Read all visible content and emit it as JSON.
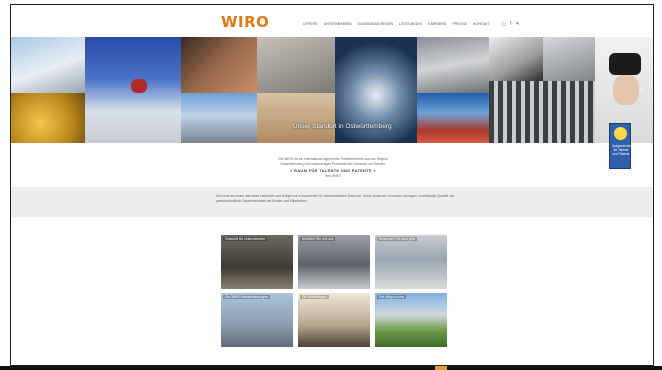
{
  "header": {
    "logo": "WIRO",
    "nav": [
      "Offers",
      "Unternehmen",
      "Gemeinsam reden",
      "Leistungen",
      "Karriere",
      "Presse",
      "Kontakt"
    ],
    "social": [
      {
        "name": "instagram-icon",
        "glyph": "◻"
      },
      {
        "name": "facebook-icon",
        "glyph": "f"
      },
      {
        "name": "xing-icon",
        "glyph": "✕"
      }
    ]
  },
  "slider": {
    "caption": "Unser Standort in Ostwürttemberg",
    "prev": "‹",
    "next": "›",
    "award_text": "Ausgezeichnet für Talente und Patente",
    "dot_count": 6
  },
  "intro": {
    "line1": "Die WIRO ist ein international agierender Familienbetrieb aus der Region",
    "line2": "Ostwürttemberg mit hochwertigen Produkten für Industrie und Handel.",
    "slogan": "» RAUM FÜR TALENTE UND PATENTE «",
    "sign": "Ihre WIRO"
  },
  "about": "Seit mehr als einem Jahrzehnt entwickeln und fertigen wir Komponenten für unterschiedliche Branchen. Unser Anspruch: innovative Lösungen, zuverlässige Qualität und partnerschaftliche Zusammenarbeit mit Kunden und Mitarbeitern.",
  "cards": [
    {
      "label": "Gesucht für Unternehmen"
    },
    {
      "label": "Arbeiten Sie mit uns"
    },
    {
      "label": "Bewerben Sie sich jetzt"
    },
    {
      "label": "Die WIRO Niederlassungen"
    },
    {
      "label": "Die Abteilungen"
    },
    {
      "label": "Der Weg zu uns"
    }
  ]
}
